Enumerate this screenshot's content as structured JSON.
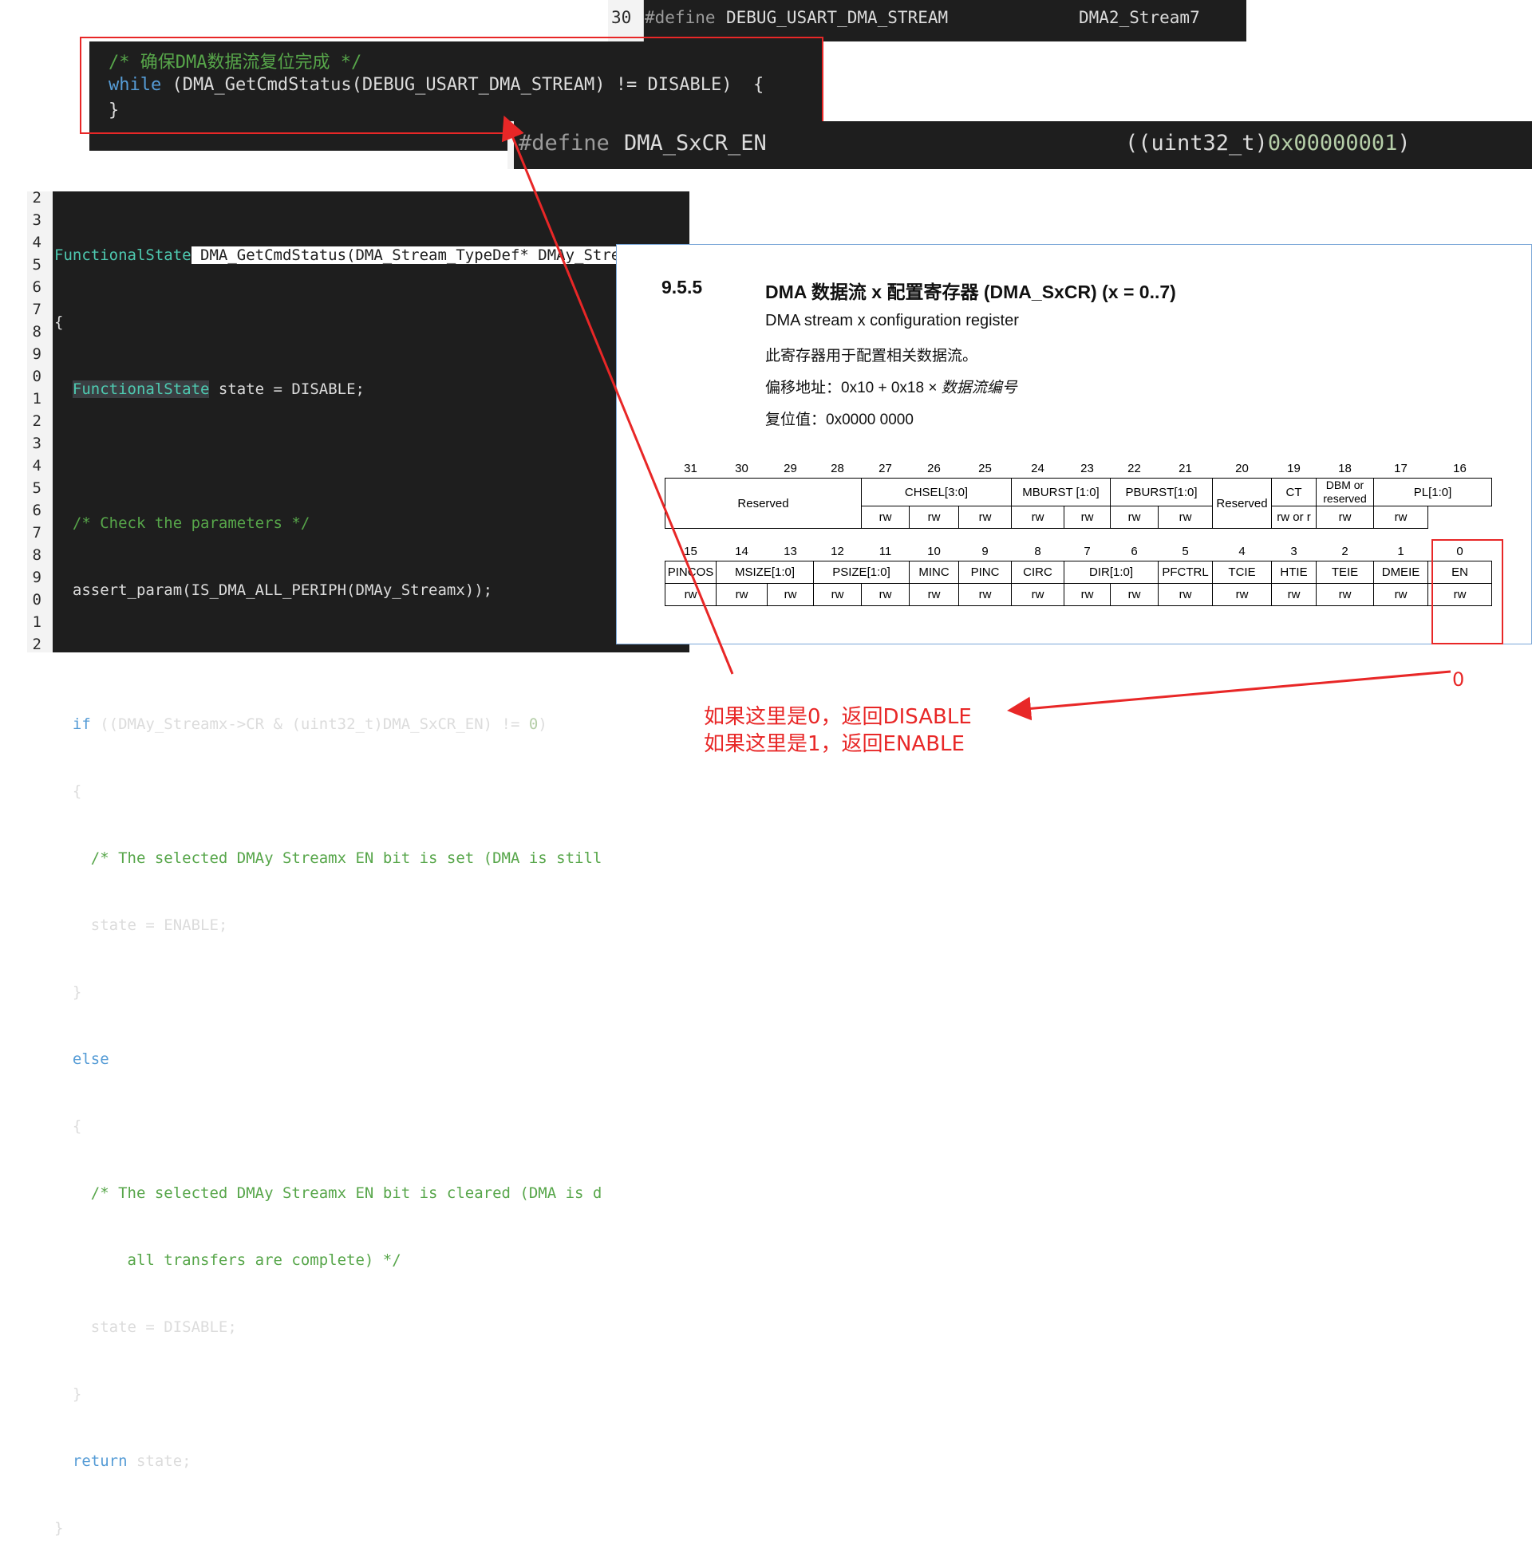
{
  "top_define": {
    "line_no": "30",
    "directive": "#define",
    "name": "DEBUG_USART_DMA_STREAM",
    "value": "DMA2_Stream7"
  },
  "snippet": {
    "comment": "/* 确保DMA数据流复位完成 */",
    "while_kw": "while",
    "while_body": " (DMA_GetCmdStatus(DEBUG_USART_DMA_STREAM) != DISABLE)  {",
    "close": "}"
  },
  "sxcr_define": {
    "directive": "#define",
    "name": "DMA_SxCR_EN",
    "value_prefix": "((uint32_t)",
    "value_hex": "0x00000001",
    "value_suffix": ")"
  },
  "code": {
    "line_numbers": [
      "2",
      "3",
      "4",
      "5",
      "6",
      "7",
      "8",
      "9",
      "0",
      "1",
      "2",
      "3",
      "4",
      "5",
      "6",
      "7",
      "8",
      "9",
      "0",
      "1",
      "2"
    ],
    "l3_type": "FunctionalState",
    "l3_sig": " DMA_GetCmdStatus(DMA_Stream_TypeDef* DMAy_Streamx)",
    "l4": "{",
    "l5_type": "FunctionalState",
    "l5_rest": " state = DISABLE;",
    "l7": "/* Check the parameters */",
    "l8": "assert_param(IS_DMA_ALL_PERIPH(DMAy_Streamx));",
    "l10_kw": "if",
    "l10_mid": " ((DMAy_Streamx->CR & (uint32_t)DMA_SxCR_EN) != ",
    "l10_num": "0",
    "l10_end": ")",
    "l11": "{",
    "l12": "/* The selected DMAy Streamx EN bit is set (DMA is still",
    "l13": "state = ENABLE;",
    "l14": "}",
    "l15": "else",
    "l16": "{",
    "l17": "/* The selected DMAy Streamx EN bit is cleared (DMA is d",
    "l18": "all transfers are complete) */",
    "l19": "state = DISABLE;",
    "l20": "}",
    "l21_kw": "return",
    "l21_rest": " state;",
    "l22": "}"
  },
  "doc": {
    "section": "9.5.5",
    "title": "DMA 数据流 x 配置寄存器 (DMA_SxCR) (x = 0..7)",
    "subtitle": "DMA stream x configuration register",
    "desc": "此寄存器用于配置相关数据流。",
    "offset_label": "偏移地址：",
    "offset_value": "0x10 + 0x18 × ",
    "offset_italic": "数据流编号",
    "reset_label": "复位值：",
    "reset_value": "0x0000 0000",
    "upper_bits": [
      "31",
      "30",
      "29",
      "28",
      "27",
      "26",
      "25",
      "24",
      "23",
      "22",
      "21",
      "20",
      "19",
      "18",
      "17",
      "16"
    ],
    "upper_fields": {
      "reserved": "Reserved",
      "chsel": "CHSEL[3:0]",
      "mburst": "MBURST [1:0]",
      "pburst": "PBURST[1:0]",
      "reserved2": "Reserved",
      "ct": "CT",
      "dbm_line1": "DBM or",
      "dbm_line2": "reserved",
      "pl": "PL[1:0]"
    },
    "upper_access": [
      "rw",
      "rw",
      "rw",
      "rw",
      "rw",
      "rw",
      "rw",
      "rw or r",
      "rw",
      "rw"
    ],
    "lower_bits": [
      "15",
      "14",
      "13",
      "12",
      "11",
      "10",
      "9",
      "8",
      "7",
      "6",
      "5",
      "4",
      "3",
      "2",
      "1",
      "0"
    ],
    "lower_fields": [
      "PINCOS",
      "MSIZE[1:0]",
      "PSIZE[1:0]",
      "MINC",
      "PINC",
      "CIRC",
      "DIR[1:0]",
      "PFCTRL",
      "TCIE",
      "HTIE",
      "TEIE",
      "DMEIE",
      "EN"
    ],
    "lower_access": [
      "rw",
      "rw",
      "rw",
      "rw",
      "rw",
      "rw",
      "rw",
      "rw",
      "rw",
      "rw",
      "rw",
      "rw",
      "rw",
      "rw",
      "rw",
      "rw"
    ]
  },
  "annotations": {
    "zero": "0",
    "line1": "如果这里是0，返回DISABLE",
    "line2": "如果这里是1，返回ENABLE",
    "color": "#e82727"
  }
}
